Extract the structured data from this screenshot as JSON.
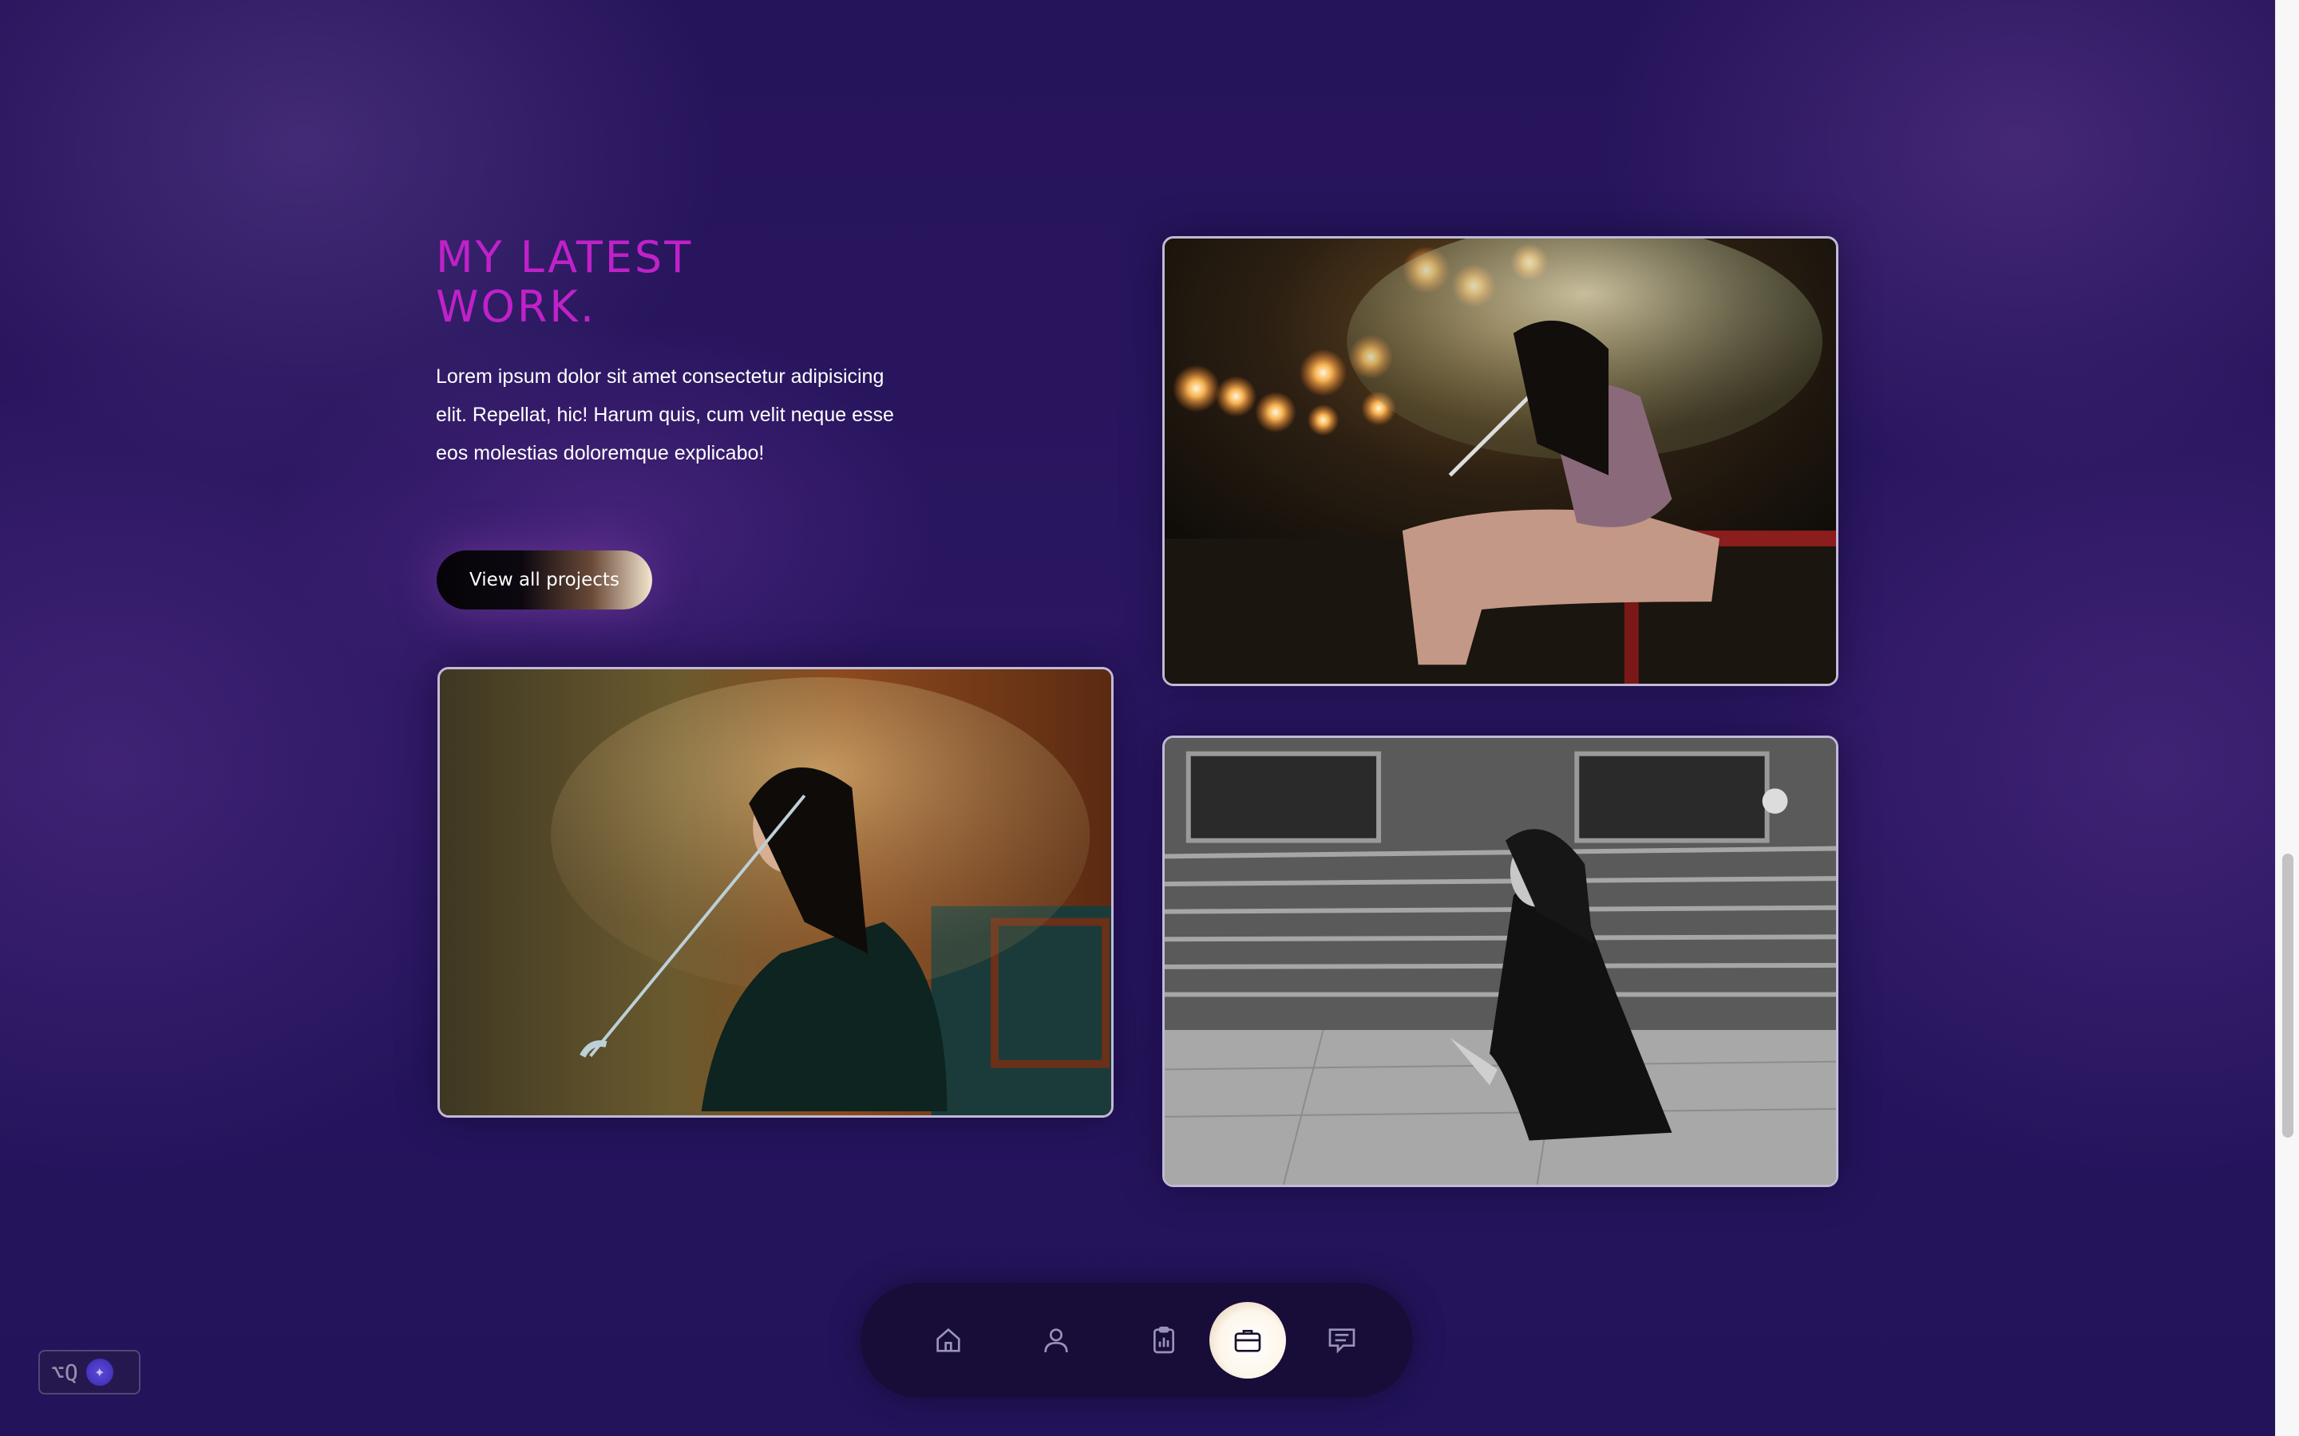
{
  "section": {
    "heading_line1": "MY LATEST",
    "heading_line2": "WORK.",
    "description": "Lorem ipsum dolor sit amet consectetur adipisicing elit. Repellat, hic! Harum quis, cum velit neque esse eos molestias doloremque explicabo!",
    "cta_label": "View all projects"
  },
  "projects": [
    {
      "alt": "Woman with clear umbrella sitting at night"
    },
    {
      "alt": "Woman with umbrella against wall at night"
    },
    {
      "alt": "Black and white woman crouching by subway train"
    }
  ],
  "dock": {
    "items": [
      {
        "icon": "home-icon",
        "active": false
      },
      {
        "icon": "user-icon",
        "active": false
      },
      {
        "icon": "clipboard-chart-icon",
        "active": false
      },
      {
        "icon": "briefcase-icon",
        "active": true
      },
      {
        "icon": "message-icon",
        "active": false
      }
    ]
  },
  "shortcut": {
    "label": "⌥Q"
  },
  "colors": {
    "accent_heading": "#c021c9",
    "background": "#26145a",
    "text": "#ffffff"
  }
}
